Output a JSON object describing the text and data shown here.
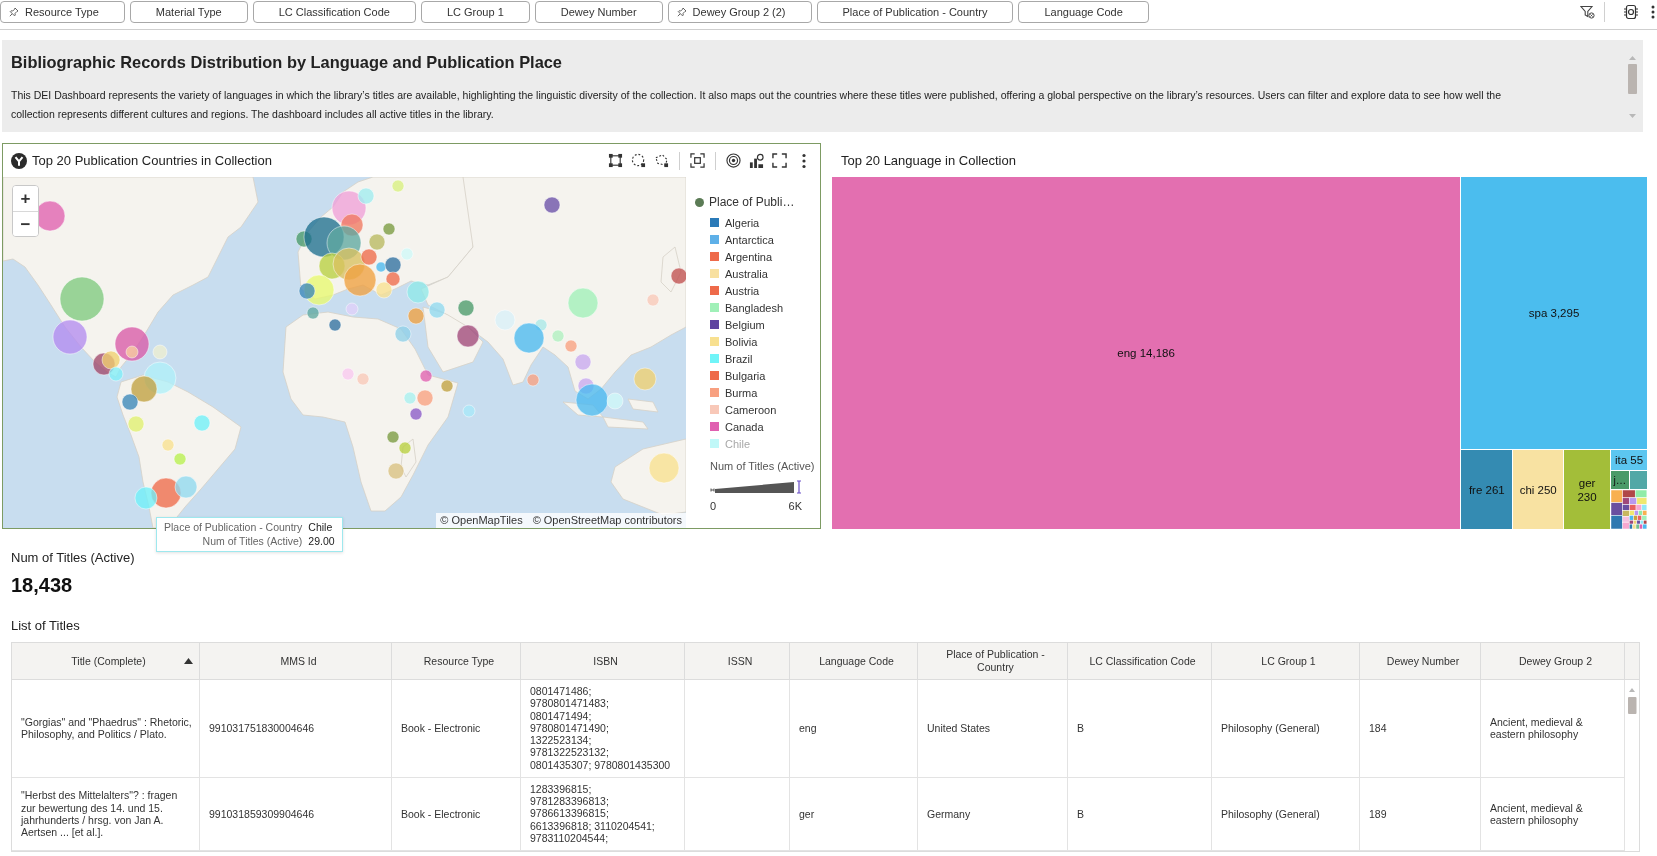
{
  "filter_bar": {
    "filters": [
      {
        "label": "Resource Type",
        "pinned": true
      },
      {
        "label": "Material Type",
        "pinned": false
      },
      {
        "label": "LC Classification Code",
        "pinned": false
      },
      {
        "label": "LC Group 1",
        "pinned": false
      },
      {
        "label": "Dewey Number",
        "pinned": false
      },
      {
        "label": "Dewey Group 2 (2)",
        "pinned": true
      },
      {
        "label": "Place of Publication - Country",
        "pinned": false
      },
      {
        "label": "Language Code",
        "pinned": false
      }
    ]
  },
  "description": {
    "title": "Bibliographic Records Distribution by Language and Publication Place",
    "text": "This DEI Dashboard represents the variety of languages in which the library’s titles are available, highlighting the linguistic diversity of the collection. It also maps out the countries where these titles were published, offering a global perspective on the library’s resources. Users can filter and explore data to see how well the collection represents different cultures and regions. The dashboard includes all active titles in the library."
  },
  "map_view": {
    "title": "Top 20 Publication Countries in Collection",
    "zoom_buttons": [
      "+",
      "−"
    ],
    "attribution": [
      "© OpenMapTiles",
      "© OpenStreetMap contributors"
    ],
    "legend": {
      "title": "Place of Publi…",
      "items": [
        {
          "label": "Algeria",
          "color": "#2a7ab8",
          "dimmed": false
        },
        {
          "label": "Antarctica",
          "color": "#5eb0e8",
          "dimmed": false
        },
        {
          "label": "Argentina",
          "color": "#ee6a4a",
          "dimmed": false
        },
        {
          "label": "Australia",
          "color": "#f8e0a0",
          "dimmed": false
        },
        {
          "label": "Austria",
          "color": "#ee6a4a",
          "dimmed": false
        },
        {
          "label": "Bangladesh",
          "color": "#a0f0b8",
          "dimmed": false
        },
        {
          "label": "Belgium",
          "color": "#5e44a0",
          "dimmed": false
        },
        {
          "label": "Bolivia",
          "color": "#f8e090",
          "dimmed": false
        },
        {
          "label": "Brazil",
          "color": "#70f4f8",
          "dimmed": false
        },
        {
          "label": "Bulgaria",
          "color": "#ee6a4a",
          "dimmed": false
        },
        {
          "label": "Burma",
          "color": "#f8a080",
          "dimmed": false
        },
        {
          "label": "Cameroon",
          "color": "#f8c8b8",
          "dimmed": false
        },
        {
          "label": "Canada",
          "color": "#e060b0",
          "dimmed": false
        },
        {
          "label": "Chile",
          "color": "#c0f8f8",
          "dimmed": true
        }
      ],
      "size_title": "Num of Titles (Active)",
      "size_min": "0",
      "size_max": "6K"
    },
    "tooltip": {
      "rows": [
        {
          "label": "Place of Publication - Country",
          "value": "Chile"
        },
        {
          "label": "Num of Titles (Active)",
          "value": "29.00"
        }
      ]
    }
  },
  "treemap": {
    "title": "Top 20 Language in Collection",
    "cells": [
      {
        "label": "eng 14,186",
        "color": "#e36fb0"
      },
      {
        "label": "spa 3,295",
        "color": "#4bbdee"
      },
      {
        "label": "fre 261",
        "color": "#348bb2"
      },
      {
        "label": "chi 250",
        "color": "#f8e2a2"
      },
      {
        "label": "ger 230",
        "color": "#a3be39"
      },
      {
        "label": "ita 55",
        "color": "#5cc6f0"
      },
      {
        "label": "j…",
        "color": "#4b9a68"
      },
      {
        "color": "#52a8a6"
      }
    ]
  },
  "kpi": {
    "label": "Num of Titles (Active)",
    "value": "18,438"
  },
  "table": {
    "title": "List of Titles",
    "columns": [
      {
        "label": "Title (Complete)",
        "sorted": true
      },
      {
        "label": "MMS Id",
        "sorted": false
      },
      {
        "label": "Resource Type",
        "sorted": false
      },
      {
        "label": "ISBN",
        "sorted": false
      },
      {
        "label": "ISSN",
        "sorted": false
      },
      {
        "label": "Language Code",
        "sorted": false
      },
      {
        "label": "Place of Publication - Country",
        "sorted": false
      },
      {
        "label": "LC Classification Code",
        "sorted": false
      },
      {
        "label": "LC Group 1",
        "sorted": false
      },
      {
        "label": "Dewey Number",
        "sorted": false
      },
      {
        "label": "Dewey Group 2",
        "sorted": false
      }
    ],
    "rows": [
      [
        "\"Gorgias\" and \"Phaedrus\" : Rhetoric, Philosophy, and Politics / Plato.",
        "991031751830004646",
        "Book - Electronic",
        "0801471486; 9780801471483; 0801471494; 9780801471490; 1322523134; 9781322523132; 0801435307; 9780801435300",
        null,
        "eng",
        "United States",
        "B",
        "Philosophy (General)",
        "184",
        "Ancient, medieval & eastern philosophy"
      ],
      [
        "\"Herbst des Mittelalters\"? : fragen zur bewertung des 14. und 15. jahrhunderts / hrsg. von Jan A. Aertsen ... [et al.].",
        "991031859309904646",
        "Book - Electronic",
        "1283396815; 9781283396813; 9786613396815; 6613396818; 3110204541; 9783110204544;",
        null,
        "ger",
        "Germany",
        "B",
        "Philosophy (General)",
        "189",
        "Ancient, medieval & eastern philosophy"
      ]
    ]
  }
}
